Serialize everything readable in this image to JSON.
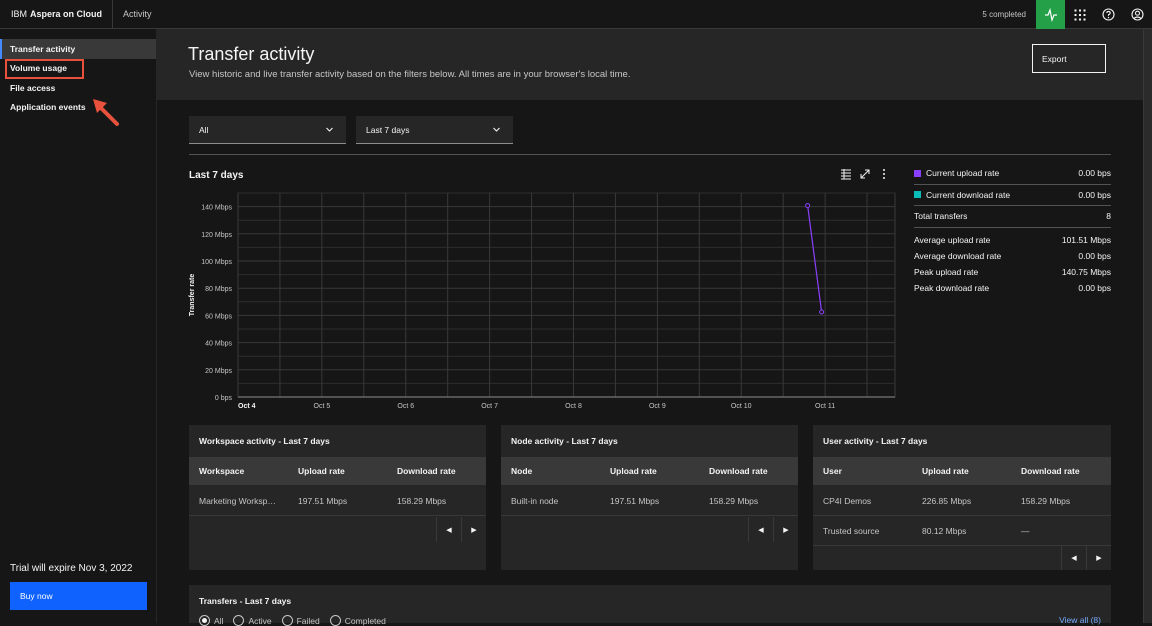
{
  "topbar": {
    "brand_prefix": "IBM",
    "brand_name": "Aspera on Cloud",
    "section": "Activity",
    "completed": "5 completed"
  },
  "sidebar": {
    "items": [
      {
        "label": "Transfer activity"
      },
      {
        "label": "Volume usage"
      },
      {
        "label": "File access"
      },
      {
        "label": "Application events"
      }
    ],
    "trial": "Trial will expire Nov 3, 2022",
    "buy": "Buy now"
  },
  "header": {
    "title": "Transfer activity",
    "subtitle": "View historic and live transfer activity based on the filters below. All times are in your browser's local time.",
    "export": "Export"
  },
  "filters": {
    "scope": "All",
    "range": "Last 7 days"
  },
  "chart_data": {
    "type": "line",
    "title": "Last 7 days",
    "ylabel": "Transfer rate",
    "xlabel": "",
    "x_ticks": [
      "Oct 4",
      "Oct 5",
      "Oct 6",
      "Oct 7",
      "Oct 8",
      "Oct 9",
      "Oct 10",
      "Oct 11"
    ],
    "y_ticks": [
      "0 bps",
      "20 Mbps",
      "40 Mbps",
      "60 Mbps",
      "80 Mbps",
      "100 Mbps",
      "120 Mbps",
      "140 Mbps"
    ],
    "ylim": [
      0,
      150
    ],
    "xlim": [
      "Oct 4",
      "Oct 11 20:00"
    ],
    "grid": true,
    "series": [
      {
        "color": "#8a3ffc",
        "points": [
          {
            "x": "Oct 10 19:00",
            "y": 140.75
          },
          {
            "x": "Oct 10 23:00",
            "y": 62.5
          }
        ]
      }
    ]
  },
  "stats": {
    "current_upload_label": "Current upload rate",
    "current_upload": "0.00 bps",
    "current_download_label": "Current download rate",
    "current_download": "0.00 bps",
    "total_label": "Total transfers",
    "total": "8",
    "avg_upload_label": "Average upload rate",
    "avg_upload": "101.51 Mbps",
    "avg_download_label": "Average download rate",
    "avg_download": "0.00 bps",
    "peak_upload_label": "Peak upload rate",
    "peak_upload": "140.75 Mbps",
    "peak_download_label": "Peak download rate",
    "peak_download": "0.00 bps",
    "upload_color": "#8a3ffc",
    "download_color": "#08bdba"
  },
  "workspace_panel": {
    "title": "Workspace activity - Last 7 days",
    "headers": [
      "Workspace",
      "Upload rate",
      "Download rate"
    ],
    "rows": [
      [
        "Marketing Workspace",
        "197.51 Mbps",
        "158.29 Mbps"
      ]
    ]
  },
  "node_panel": {
    "title": "Node activity - Last 7 days",
    "headers": [
      "Node",
      "Upload rate",
      "Download rate"
    ],
    "rows": [
      [
        "Built-in node",
        "197.51 Mbps",
        "158.29 Mbps"
      ]
    ]
  },
  "user_panel": {
    "title": "User activity - Last 7 days",
    "headers": [
      "User",
      "Upload rate",
      "Download rate"
    ],
    "rows": [
      [
        "CP4I Demos",
        "226.85 Mbps",
        "158.29 Mbps"
      ],
      [
        "Trusted source",
        "80.12 Mbps",
        "—"
      ]
    ]
  },
  "transfers": {
    "title": "Transfers - Last 7 days",
    "filters": [
      "All",
      "Active",
      "Failed",
      "Completed"
    ],
    "view_all": "View all (8)"
  },
  "icons": {
    "activity": "activity-icon",
    "apps": "app-switcher-icon",
    "help": "help-icon",
    "user": "user-avatar-icon"
  },
  "colors": {
    "accent": "#0f62fe",
    "activity_active": "#24a148",
    "annotation": "#e8523d"
  }
}
